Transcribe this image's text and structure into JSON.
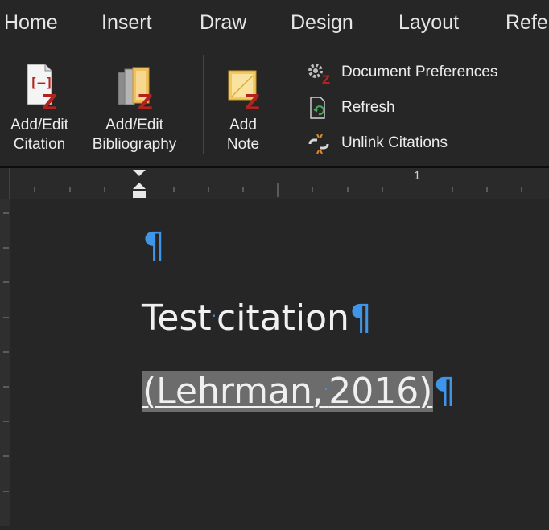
{
  "tabs": [
    "Home",
    "Insert",
    "Draw",
    "Design",
    "Layout",
    "Refe"
  ],
  "ribbon": {
    "add_edit_citation": [
      "Add/Edit",
      "Citation"
    ],
    "add_edit_bibliography": [
      "Add/Edit",
      "Bibliography"
    ],
    "add_note": [
      "Add",
      "Note"
    ],
    "document_preferences": "Document Preferences",
    "refresh": "Refresh",
    "unlink_citations": "Unlink Citations"
  },
  "ruler": {
    "mark": "1"
  },
  "document": {
    "pilcrow": "¶",
    "line1_a": "Test",
    "line1_b": "citation",
    "citation_a": "(Lehrman,",
    "citation_b": "2016)"
  },
  "colors": {
    "accent": "#3f95e8",
    "zotero_red": "#b0231f",
    "selection": "#6c6c6c"
  }
}
